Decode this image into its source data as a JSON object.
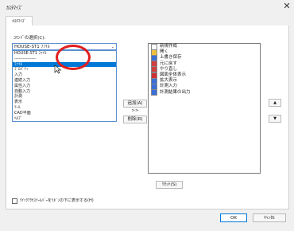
{
  "window": {
    "title": "ｶｽﾀﾏｲｽﾞ",
    "close_glyph": "✕"
  },
  "tabs": [
    {
      "label": "ｶｽﾀﾏｲｽﾞ"
    }
  ],
  "command_select": {
    "label": "ｺﾏﾝﾄﾞの選択(C):",
    "value": "HOUSE-ST1 ﾌｧｲﾙ",
    "options": [
      "HOUSE-ST1 ﾌｧｲﾙ",
      "---------------",
      "ﾌｧｲﾙ",
      "ﾌﾟﾛﾊﾟﾃｨ",
      "入力",
      "連続入力",
      "属性入力",
      "自動入力",
      "計測",
      "表示",
      "ﾂｰﾙ",
      "CAD平面",
      "ﾍﾙﾌﾟ"
    ],
    "selected_index": 2
  },
  "buttons": {
    "add": "追加(A) >>",
    "remove": "削除(R)",
    "reset": "ﾘｾｯﾄ(S)",
    "ok": "OK",
    "cancel": "ｷｬﾝｾﾙ",
    "up_glyph": "▲",
    "down_glyph": "▼"
  },
  "toolbar_items": [
    {
      "label": "新規作成",
      "icon": "new-file-icon",
      "color": "#ffffff"
    },
    {
      "label": "開く",
      "icon": "open-folder-icon",
      "color": "#f0c040"
    },
    {
      "label": "上書き保存",
      "icon": "save-icon",
      "color": "#3a6fd8"
    },
    {
      "label": "元に戻す",
      "icon": "undo-icon",
      "color": "#d04040"
    },
    {
      "label": "やり直し",
      "icon": "redo-icon",
      "color": "#d04040"
    },
    {
      "label": "図面全体表示",
      "icon": "fit-view-icon",
      "color": "#d03030"
    },
    {
      "label": "拡大表示",
      "icon": "zoom-in-icon",
      "color": "#3a6fd8"
    },
    {
      "label": "計測入力",
      "icon": "measure-icon",
      "color": "#3a6fd8"
    },
    {
      "label": "計測結果の出力",
      "icon": "measure-output-icon",
      "color": "#3a6fd8"
    }
  ],
  "checkbox": {
    "label": "ｸｲｯｸｱｸｾｽﾂｰﾙﾊﾞｰをﾘﾎﾞﾝの下に表示する(H)",
    "checked": false
  },
  "annotation": {
    "color": "#e01e1e"
  }
}
